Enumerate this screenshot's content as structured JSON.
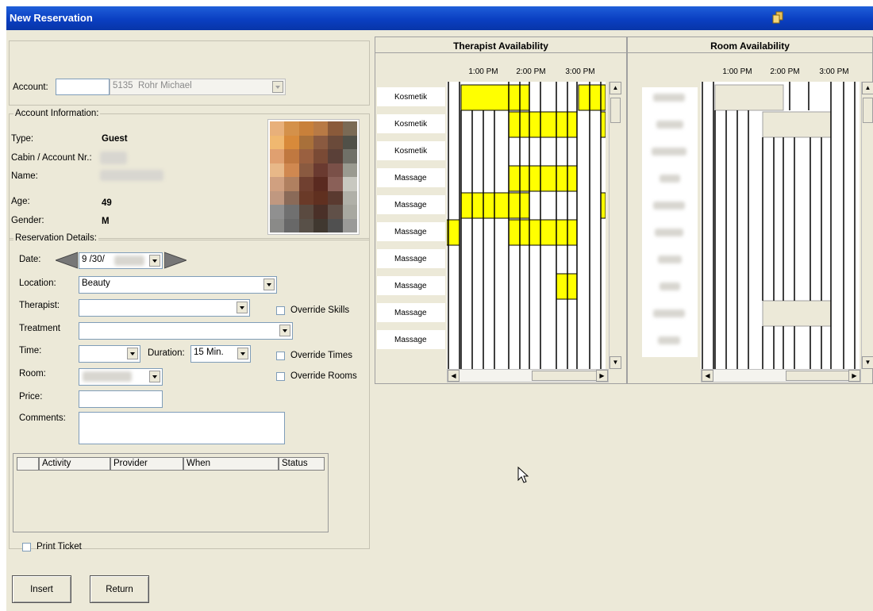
{
  "window": {
    "title": "New Reservation"
  },
  "account": {
    "label": "Account:",
    "id": "5135",
    "name": "Rohr Michael"
  },
  "account_info": {
    "legend": "Account Information:",
    "type_label": "Type:",
    "type_value": "Guest",
    "cabin_label": "Cabin / Account Nr.:",
    "name_label": "Name:",
    "age_label": "Age:",
    "age_value": "49",
    "gender_label": "Gender:",
    "gender_value": "M"
  },
  "reservation": {
    "legend": "Reservation Details:",
    "date_label": "Date:",
    "date_value": "9 /30/",
    "location_label": "Location:",
    "location_value": "Beauty",
    "therapist_label": "Therapist:",
    "treatment_label": "Treatment",
    "time_label": "Time:",
    "duration_label": "Duration:",
    "duration_value": "15 Min.",
    "room_label": "Room:",
    "price_label": "Price:",
    "comments_label": "Comments:",
    "override_skills": "Override Skills",
    "override_times": "Override Times",
    "override_rooms": "Override Rooms"
  },
  "activity_table": {
    "columns": [
      "Activity",
      "Provider",
      "When",
      "Status"
    ]
  },
  "print_ticket": "Print Ticket",
  "buttons": {
    "insert": "Insert",
    "return": "Return"
  },
  "therapist_panel": {
    "title": "Therapist Availability",
    "times": [
      "1:00 PM",
      "2:00 PM",
      "3:00 PM"
    ],
    "rows": [
      "Kosmetik",
      "Kosmetik",
      "Kosmetik",
      "Massage",
      "Massage",
      "Massage",
      "Massage",
      "Massage",
      "Massage",
      "Massage"
    ]
  },
  "room_panel": {
    "title": "Room Availability",
    "times": [
      "1:00 PM",
      "2:00 PM",
      "3:00 PM"
    ]
  },
  "colors": {
    "titlebar": "#0a3fc2",
    "booked": "#ffff00",
    "window_bg": "#ece9d8"
  }
}
